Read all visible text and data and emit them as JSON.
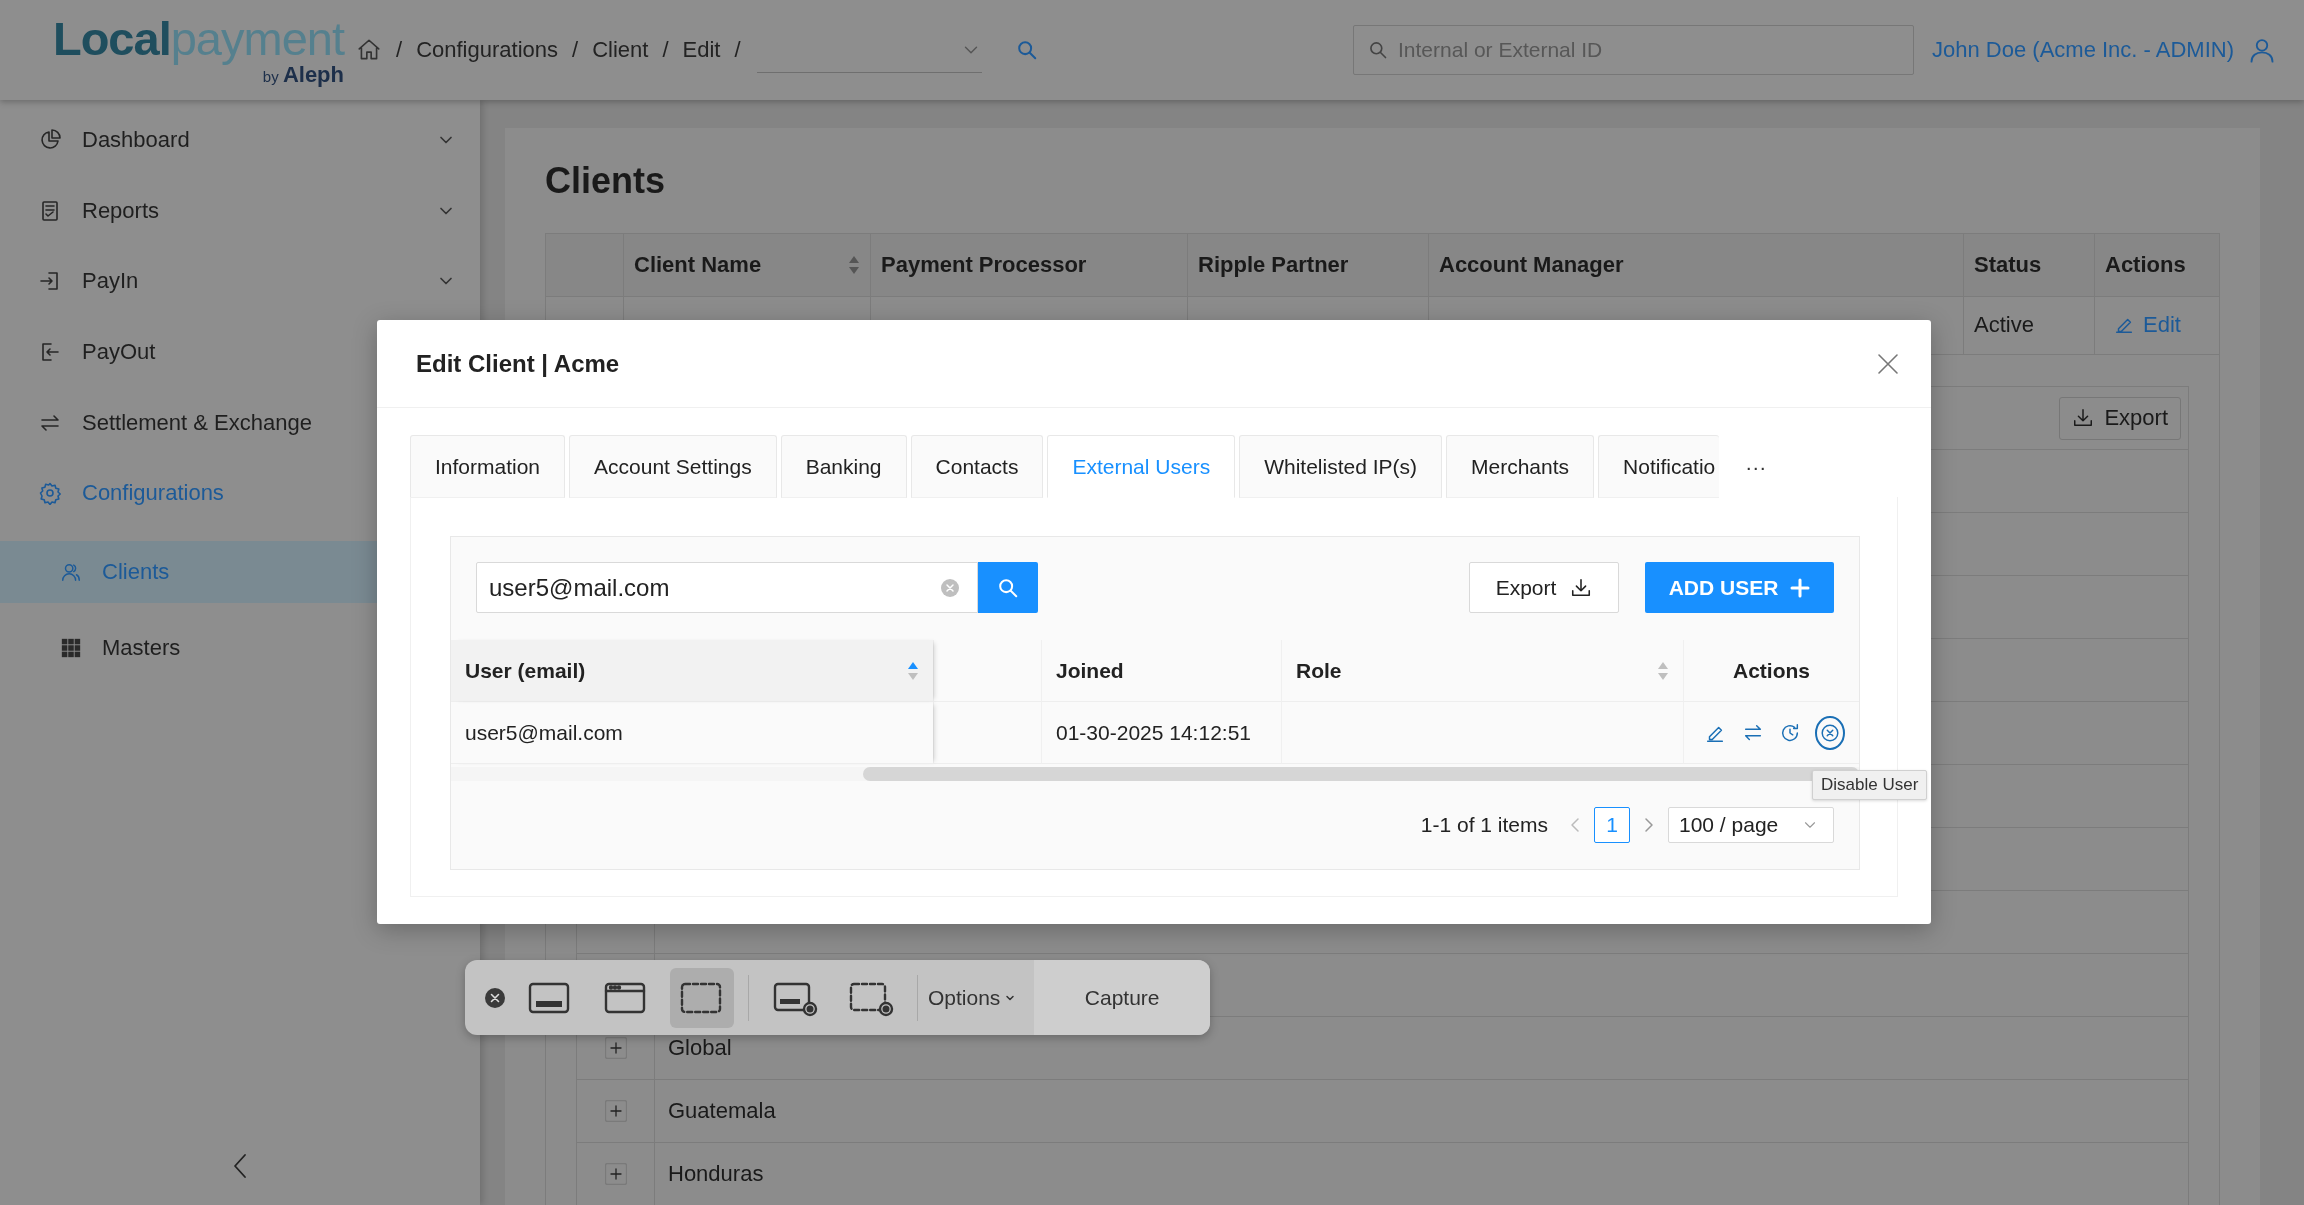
{
  "header": {
    "logo": {
      "wordmark": [
        "Local",
        "payment"
      ],
      "byline": "by **Aleph**"
    },
    "breadcrumb": {
      "items": [
        "Configurations",
        "Client",
        "Edit"
      ],
      "separator": "/"
    },
    "search": {
      "placeholder": "Internal or External ID"
    },
    "user": "John Doe (Acme Inc. - ADMIN)"
  },
  "sidebar": {
    "items": [
      {
        "label": "Dashboard",
        "expandable": true,
        "selected": false
      },
      {
        "label": "Reports",
        "expandable": true,
        "selected": false
      },
      {
        "label": "PayIn",
        "expandable": true,
        "selected": false
      },
      {
        "label": "PayOut",
        "selected": false
      },
      {
        "label": "Settlement & Exchange",
        "selected": false
      },
      {
        "label": "Configurations",
        "selected": true,
        "children": [
          {
            "label": "Clients",
            "selected": true
          },
          {
            "label": "Masters",
            "selected": false
          }
        ]
      }
    ]
  },
  "page": {
    "title": "Clients",
    "table": {
      "columns": [
        {
          "label": "Client Name",
          "sortable": true
        },
        {
          "label": "Payment Processor",
          "sortable": false
        },
        {
          "label": "Ripple Partner",
          "sortable": false
        },
        {
          "label": "Account Manager",
          "sortable": false
        },
        {
          "label": "Status",
          "sortable": false
        },
        {
          "label": "Actions",
          "sortable": false
        }
      ],
      "rows": [
        {
          "status": "Active",
          "action": "Edit"
        }
      ]
    },
    "sub_table": {
      "export": "Export",
      "rows": [
        {
          "name": "Global"
        },
        {
          "name": "Guatemala"
        },
        {
          "name": "Honduras"
        }
      ]
    }
  },
  "modal": {
    "title": "Edit Client | Acme",
    "tabs": [
      {
        "label": "Information",
        "selected": false
      },
      {
        "label": "Account Settings",
        "selected": false
      },
      {
        "label": "Banking",
        "selected": false
      },
      {
        "label": "Contacts",
        "selected": false
      },
      {
        "label": "External Users",
        "selected": true
      },
      {
        "label": "Whitelisted IP(s)",
        "selected": false
      },
      {
        "label": "Merchants",
        "selected": false
      },
      {
        "label": "Notificatio",
        "selected": false
      }
    ],
    "more": "···",
    "search": {
      "value": "user5@mail.com"
    },
    "export": "Export",
    "add_user": "ADD USER",
    "table": {
      "columns": [
        {
          "kind": "text",
          "label": "User (email)",
          "sortable": true,
          "sorted_ascending": true
        },
        {
          "kind": "spacer"
        },
        {
          "kind": "text",
          "label": "Joined"
        },
        {
          "kind": "text",
          "label": "Role",
          "sortable": true,
          "sorted_ascending": false
        },
        {
          "kind": "center",
          "label": "Actions"
        }
      ],
      "rows": [
        {
          "user": "user5@mail.com",
          "joined": "01-30-2025 14:12:51",
          "actions": [
            {
              "focused": false
            },
            {
              "focused": false
            },
            {
              "focused": false
            },
            {
              "focused": true
            }
          ]
        }
      ],
      "tooltip": "Disable User"
    },
    "pagination": {
      "summary": "1-1 of 1 items",
      "pages": [
        {
          "label": "1",
          "selected": true
        }
      ],
      "page_size": "100 / page"
    }
  },
  "capture_bar": {
    "modes": [
      {
        "selected": false
      },
      {
        "selected": false
      },
      {
        "selected": true
      },
      {
        "selected": false
      },
      {
        "selected": false
      }
    ],
    "options": "Options",
    "capture": "Capture"
  }
}
